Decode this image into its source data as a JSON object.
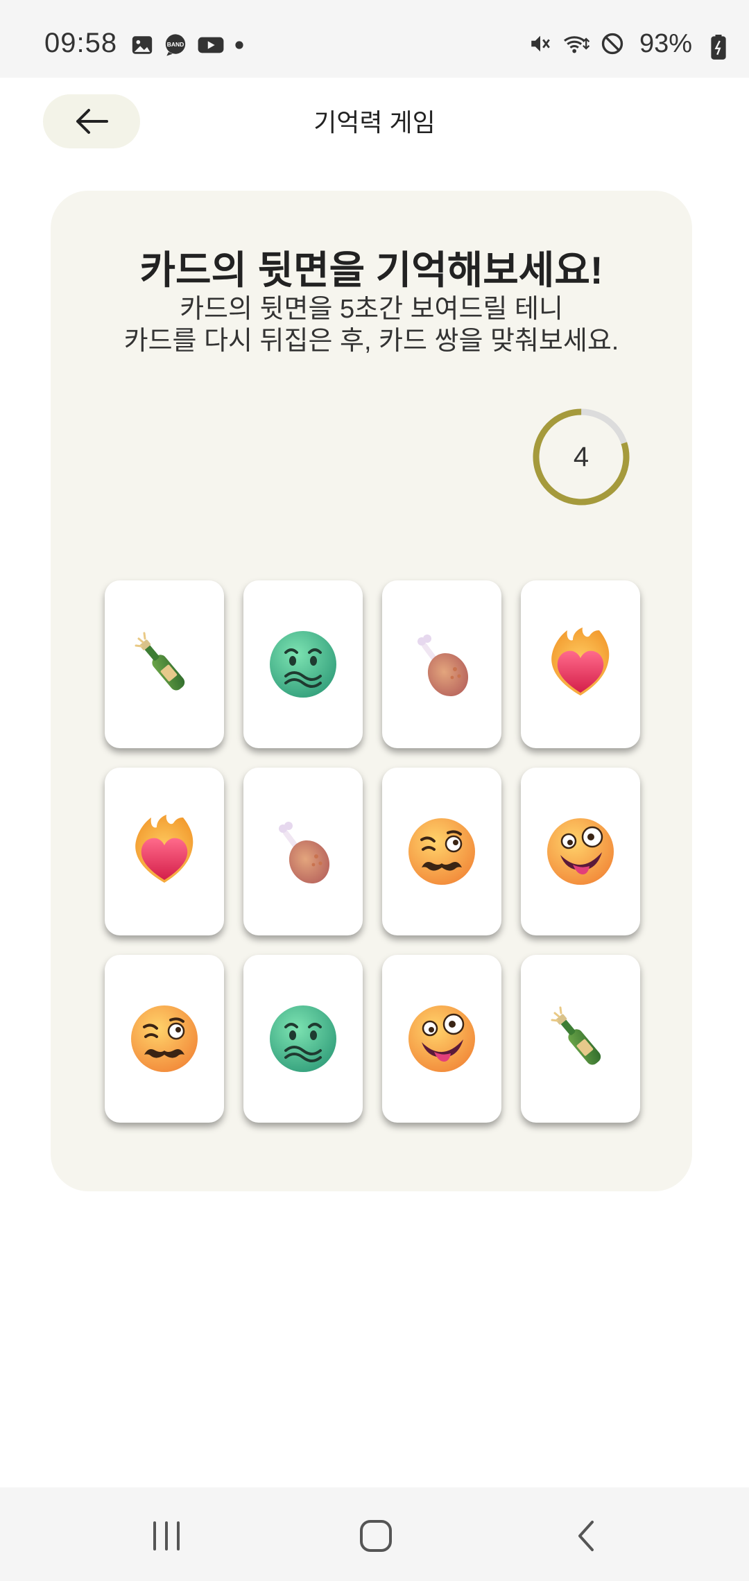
{
  "status_bar": {
    "time": "09:58",
    "battery": "93%",
    "left_icons": [
      "gallery-icon",
      "band-icon",
      "youtube-icon",
      "dot-icon"
    ],
    "right_icons": [
      "mute-icon",
      "wifi-icon",
      "no-disturb-icon",
      "battery-icon"
    ]
  },
  "header": {
    "title": "기억력 게임",
    "back_icon": "arrow-left-icon"
  },
  "panel": {
    "title": "카드의 뒷면을 기억해보세요!",
    "desc_line1": "카드의 뒷면을 5초간 보여드릴 테니",
    "desc_line2": "카드를 다시 뒤집은 후, 카드 쌍을 맞춰보세요.",
    "timer_value": "4",
    "timer_progress": 0.8,
    "accent_color": "#a59a3c"
  },
  "cards": [
    {
      "icon": "champagne-icon"
    },
    {
      "icon": "nauseated-face-icon"
    },
    {
      "icon": "chicken-leg-icon"
    },
    {
      "icon": "heart-on-fire-icon"
    },
    {
      "icon": "heart-on-fire-icon"
    },
    {
      "icon": "chicken-leg-icon"
    },
    {
      "icon": "woozy-mustache-face-icon"
    },
    {
      "icon": "zany-face-icon"
    },
    {
      "icon": "woozy-mustache-face-icon"
    },
    {
      "icon": "nauseated-face-icon"
    },
    {
      "icon": "zany-face-icon"
    },
    {
      "icon": "champagne-icon"
    }
  ],
  "nav_bar": {
    "items": [
      "recent-apps-icon",
      "home-icon",
      "back-icon"
    ]
  }
}
